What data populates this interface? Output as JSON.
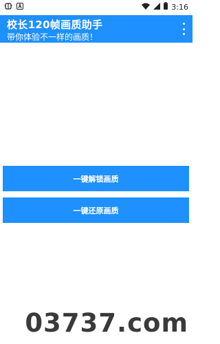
{
  "status": {
    "time": "3:16",
    "icons": [
      "bug-icon",
      "a-icon",
      "wifi-icon",
      "signal-icon",
      "battery-icon"
    ]
  },
  "app_bar": {
    "title": "校长120帧画质助手",
    "subtitle": "带你体验不一样的画质！"
  },
  "buttons": {
    "unlock_label": "一键解锁画质",
    "restore_label": "一键还原画质"
  },
  "watermark": "03737.com",
  "misc": {
    "left_small": "",
    "bottom_left": ""
  },
  "colors": {
    "primary": "#1e90ff"
  }
}
